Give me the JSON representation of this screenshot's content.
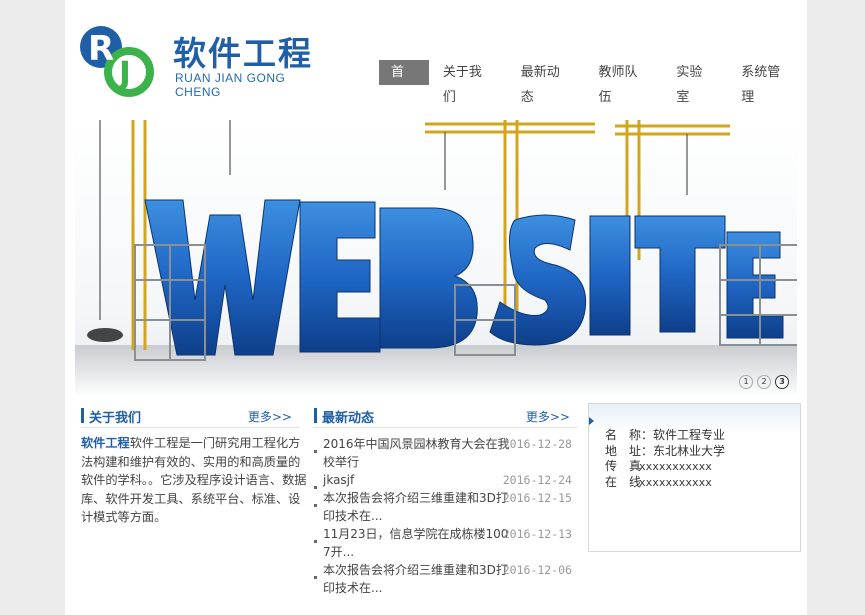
{
  "logo": {
    "letters": "RJ",
    "title_cn": "软件工程",
    "title_en": "RUAN JIAN GONG CHENG"
  },
  "nav": {
    "items": [
      "首页",
      "关于我们",
      "最新动态",
      "教师队伍",
      "实验室",
      "系统管理"
    ],
    "active_index": 0
  },
  "banner": {
    "text": "WEBSITE",
    "dots": [
      "1",
      "2",
      "3"
    ],
    "active_dot": 2
  },
  "about": {
    "title": "关于我们",
    "more": "更多>>",
    "lead": "软件工程",
    "text": "软件工程是一门研究用工程化方法构建和维护有效的、实用的和高质量的软件的学科。。它涉及程序设计语言、数据库、软件开发工具、系统平台、标准、设计模式等方面。"
  },
  "news": {
    "title": "最新动态",
    "more": "更多>>",
    "items": [
      {
        "title": "2016年中国风景园林教育大会在我校举行",
        "date": "2016-12-28"
      },
      {
        "title": "jkasjf",
        "date": "2016-12-24"
      },
      {
        "title": "本次报告会将介绍三维重建和3D打印技术在...",
        "date": "2016-12-15"
      },
      {
        "title": "11月23日，信息学院在成栋楼1007开...",
        "date": "2016-12-13"
      },
      {
        "title": "本次报告会将介绍三维重建和3D打印技术在...",
        "date": "2016-12-06"
      }
    ]
  },
  "contact": {
    "rows": [
      {
        "label": "名　称：",
        "value": "软件工程专业"
      },
      {
        "label": "地　址：",
        "value": "东北林业大学"
      },
      {
        "label": "传　真",
        "value": "xxxxxxxxxxx"
      },
      {
        "label": "在　线",
        "value": "xxxxxxxxxxx"
      }
    ]
  },
  "colors": {
    "brand_blue": "#1f5fa8",
    "logo_green": "#3bb34a",
    "nav_active_bg": "#777777",
    "page_bg": "#ebebeb"
  }
}
